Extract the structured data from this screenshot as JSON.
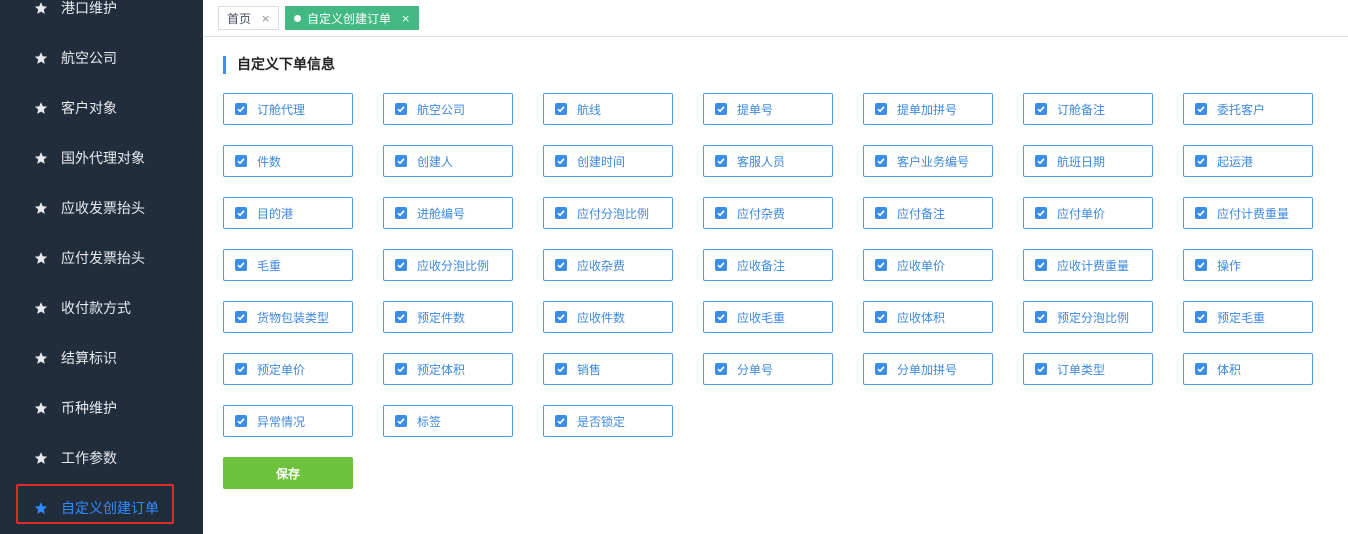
{
  "sidebar": {
    "items": [
      {
        "label": "港口维护",
        "icon": "star-icon"
      },
      {
        "label": "航空公司",
        "icon": "star-icon"
      },
      {
        "label": "客户对象",
        "icon": "star-icon"
      },
      {
        "label": "国外代理对象",
        "icon": "star-icon"
      },
      {
        "label": "应收发票抬头",
        "icon": "star-icon"
      },
      {
        "label": "应付发票抬头",
        "icon": "star-icon"
      },
      {
        "label": "收付款方式",
        "icon": "star-icon"
      },
      {
        "label": "结算标识",
        "icon": "star-icon"
      },
      {
        "label": "币种维护",
        "icon": "star-icon"
      },
      {
        "label": "工作参数",
        "icon": "star-icon"
      },
      {
        "label": "自定义创建订单",
        "icon": "star-icon",
        "active": true
      }
    ],
    "active_color": "#2f8cff",
    "background": "#222d3c"
  },
  "tabs": [
    {
      "label": "首页",
      "close": "×",
      "active": false
    },
    {
      "label": "自定义创建订单",
      "close": "×",
      "active": true
    }
  ],
  "section": {
    "title": "自定义下单信息"
  },
  "fields": [
    "订舱代理",
    "航空公司",
    "航线",
    "提单号",
    "提单加拼号",
    "订舱备注",
    "委托客户",
    "件数",
    "创建人",
    "创建时间",
    "客服人员",
    "客户业务编号",
    "航班日期",
    "起运港",
    "目的港",
    "进舱编号",
    "应付分泡比例",
    "应付杂费",
    "应付备注",
    "应付单价",
    "应付计费重量",
    "毛重",
    "应收分泡比例",
    "应收杂费",
    "应收备注",
    "应收单价",
    "应收计费重量",
    "操作",
    "货物包装类型",
    "预定件数",
    "应收件数",
    "应收毛重",
    "应收体积",
    "预定分泡比例",
    "预定毛重",
    "预定单价",
    "预定体积",
    "销售",
    "分单号",
    "分单加拼号",
    "订单类型",
    "体积",
    "异常情况",
    "标签",
    "是否锁定"
  ],
  "save_label": "保存",
  "colors": {
    "accent": "#3a8ee6",
    "tab_active": "#42b983",
    "save": "#6cc23d",
    "highlight_border": "#e32a2a"
  }
}
